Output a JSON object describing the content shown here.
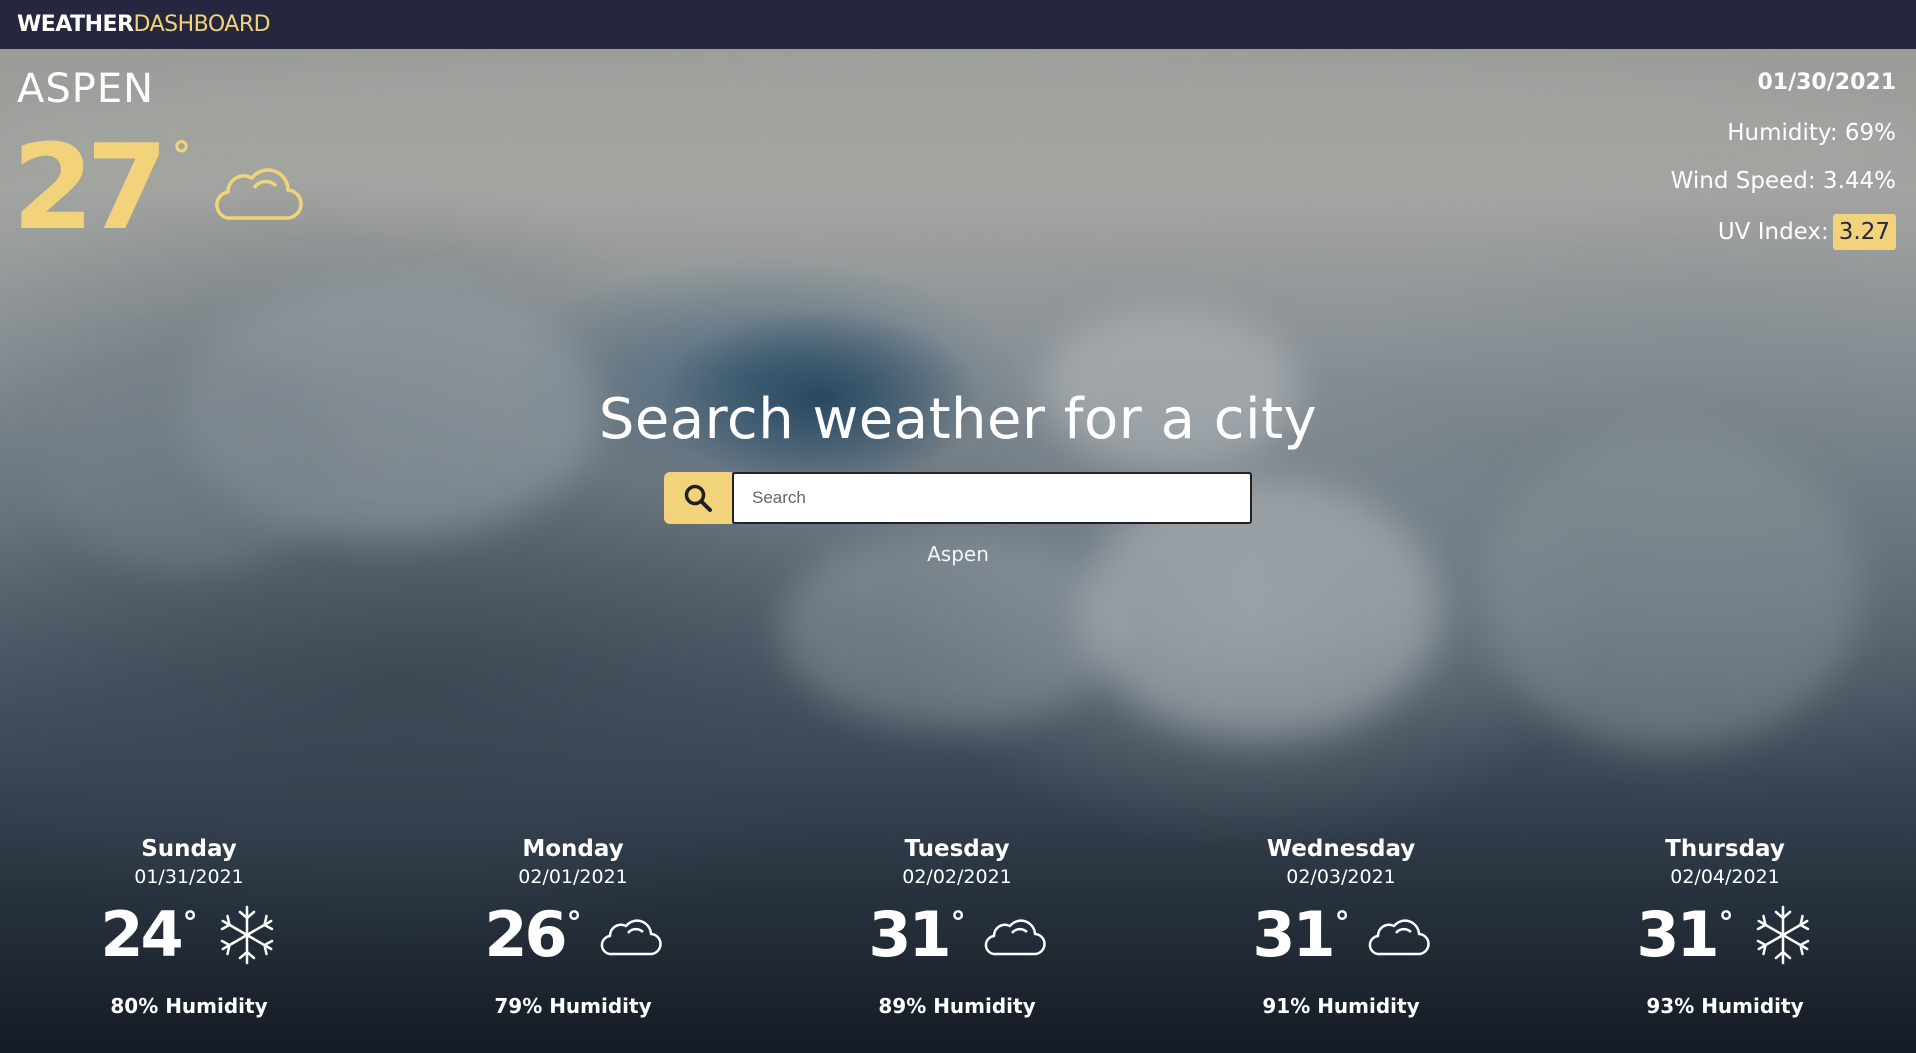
{
  "header": {
    "brand_part1": "WEATHER",
    "brand_part2": "DASHBOARD"
  },
  "current": {
    "city": "ASPEN",
    "temp": "27",
    "degree": "°",
    "condition_icon": "cloud-icon",
    "date": "01/30/2021",
    "humidity": "Humidity: 69%",
    "wind": "Wind Speed: 3.44%",
    "uv_label": "UV Index:",
    "uv_value": "3.27"
  },
  "search": {
    "title": "Search weather for a city",
    "placeholder": "Search",
    "button_icon": "search-icon",
    "history": [
      "Aspen"
    ]
  },
  "forecast": [
    {
      "day": "Sunday",
      "date": "01/31/2021",
      "temp": "24",
      "degree": "°",
      "icon": "snowflake-icon",
      "humidity": "80% Humidity"
    },
    {
      "day": "Monday",
      "date": "02/01/2021",
      "temp": "26",
      "degree": "°",
      "icon": "cloud-icon",
      "humidity": "79% Humidity"
    },
    {
      "day": "Tuesday",
      "date": "02/02/2021",
      "temp": "31",
      "degree": "°",
      "icon": "cloud-icon",
      "humidity": "89% Humidity"
    },
    {
      "day": "Wednesday",
      "date": "02/03/2021",
      "temp": "31",
      "degree": "°",
      "icon": "cloud-icon",
      "humidity": "91% Humidity"
    },
    {
      "day": "Thursday",
      "date": "02/04/2021",
      "temp": "31",
      "degree": "°",
      "icon": "snowflake-icon",
      "humidity": "93% Humidity"
    }
  ],
  "colors": {
    "accent": "#f2d27a",
    "topbar": "#25273f",
    "text": "#ffffff"
  }
}
